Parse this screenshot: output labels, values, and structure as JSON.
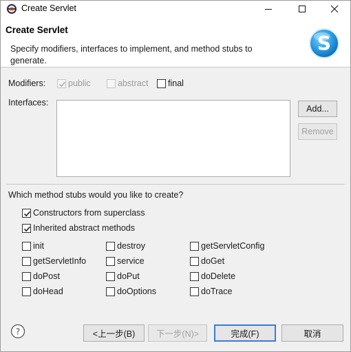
{
  "window": {
    "title": "Create Servlet"
  },
  "banner": {
    "title": "Create Servlet",
    "description": "Specify modifiers, interfaces to implement, and method stubs to generate."
  },
  "modifiers": {
    "label": "Modifiers:",
    "public": {
      "label": "public",
      "checked": true,
      "enabled": false
    },
    "abstract": {
      "label": "abstract",
      "checked": false,
      "enabled": false
    },
    "final": {
      "label": "final",
      "checked": false,
      "enabled": true
    }
  },
  "interfaces": {
    "label": "Interfaces:",
    "add_label": "Add...",
    "remove_label": "Remove"
  },
  "stubs": {
    "question": "Which method stubs would you like to create?",
    "constructors": {
      "label": "Constructors from superclass",
      "checked": true
    },
    "inherited": {
      "label": "Inherited abstract methods",
      "checked": true
    },
    "methods": [
      {
        "label": "init",
        "checked": false
      },
      {
        "label": "destroy",
        "checked": false
      },
      {
        "label": "getServletConfig",
        "checked": false
      },
      {
        "label": "getServletInfo",
        "checked": false
      },
      {
        "label": "service",
        "checked": false
      },
      {
        "label": "doGet",
        "checked": false
      },
      {
        "label": "doPost",
        "checked": false
      },
      {
        "label": "doPut",
        "checked": false
      },
      {
        "label": "doDelete",
        "checked": false
      },
      {
        "label": "doHead",
        "checked": false
      },
      {
        "label": "doOptions",
        "checked": false
      },
      {
        "label": "doTrace",
        "checked": false
      }
    ]
  },
  "footer": {
    "back_label": "<上一步(B)",
    "next_label": "下一步(N)>",
    "finish_label": "完成(F)",
    "cancel_label": "取消"
  },
  "colors": {
    "accent": "#3b7ad8",
    "logo": "#2a9be0"
  }
}
